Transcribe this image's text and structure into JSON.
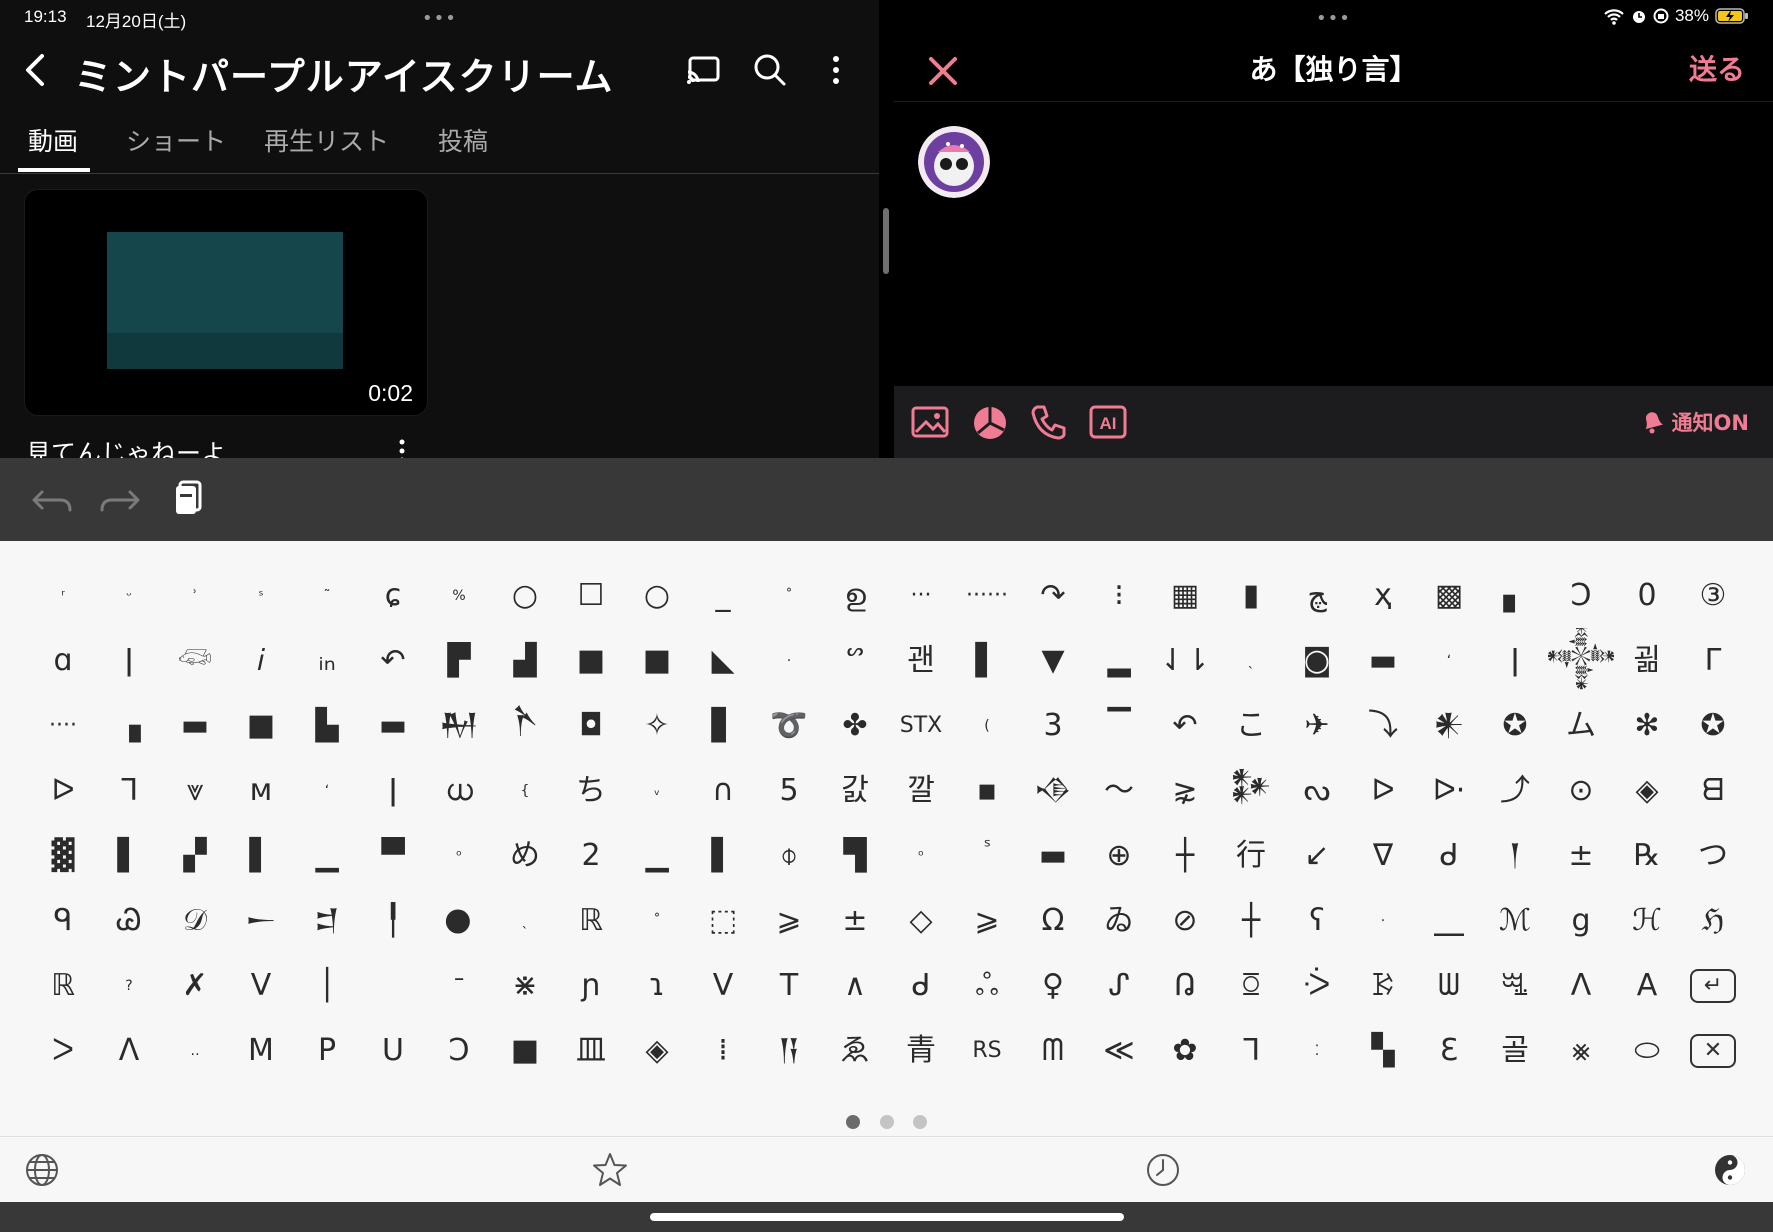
{
  "status_bar": {
    "time": "19:13",
    "date": "12月20日(土)",
    "battery": "38%",
    "dots_left": "•••",
    "dots_right": "•••"
  },
  "youtube": {
    "channel_title": "ミントパープルアイスクリーム",
    "tabs": [
      {
        "label": "動画",
        "active": true
      },
      {
        "label": "ショート",
        "active": false
      },
      {
        "label": "再生リスト",
        "active": false
      },
      {
        "label": "投稿",
        "active": false
      }
    ],
    "video": {
      "duration": "0:02",
      "title": "見てんじゃねーよ"
    }
  },
  "post": {
    "title": "あ【独り言】",
    "send_label": "送る",
    "notify_label": "通知ON",
    "accent_color": "#f07c93",
    "tool_icons": [
      "image-icon",
      "pie-icon",
      "phone-icon",
      "ai-icon"
    ],
    "ai_label": "AI"
  },
  "keyboard": {
    "toolbar_icons": [
      "undo-icon",
      "redo-icon",
      "clipboard-icon"
    ],
    "rows": [
      [
        "ʳ",
        "ᵕ",
        "ʾ",
        "ˢ",
        "˜",
        "ɕ",
        "%",
        "○",
        "☐",
        "○",
        "_",
        "˚",
        "ഉ",
        "···",
        "······",
        "↷",
        "⁝",
        "▦",
        "▮",
        "ﭻ",
        "ҳ",
        "▩",
        "▖",
        "Ɔ",
        "0",
        "③"
      ],
      [
        "ɑ",
        "ǀ",
        "𓆛",
        "𝑖",
        "ᵢₙ",
        "↶",
        "▛",
        "▟",
        "■",
        "■",
        "◣",
        "·",
        "ᔥ",
        "괜",
        "▌",
        "▼",
        "▂",
        "⇃⇂",
        "ˎ",
        "◙",
        "▬",
        "ʻ",
        "ǀ",
        "𒀱",
        "괾",
        "ᒥ"
      ],
      [
        "····",
        "▗",
        "▬",
        "■",
        "▙",
        "▬",
        "𒈹",
        "𒋻",
        "◘",
        "✧",
        "▋",
        "➰",
        "✤",
        "STX",
        "(",
        "3",
        "▔",
        "↶",
        "こ",
        "✈",
        "⤵",
        "𒀭",
        "✪",
        "ム",
        "✻",
        "✪"
      ],
      [
        "ᐅ",
        "ᒣ",
        "⩔",
        "ᴍ",
        "ʻ",
        "ǀ",
        "ധ",
        "{",
        "ち",
        "ᵥ",
        "∩",
        "5",
        "갌",
        "깔",
        "▪",
        "𒈾",
        "～",
        "⋧",
        "𒀯",
        "ᔓ",
        "ᐅ",
        "ᐅ·",
        "⤴",
        "⊙",
        "◈",
        "ᗺ"
      ],
      [
        "▓",
        "▌",
        "▞",
        "▌",
        "▁",
        "▀",
        "ᵒ",
        "め",
        "2",
        "▁",
        "▌",
        "⌽",
        "▜",
        "ᵒ",
        "ᷤ",
        "▬",
        "⊕",
        "┼",
        "行",
        "↙",
        "∇",
        "ᑯ",
        "𒁹",
        "±",
        "℞",
        "つ"
      ],
      [
        "ᑫ",
        "Ꮚ",
        "𝒟",
        "𒀸",
        "𒄑",
        "╿",
        "𒊹",
        "ˎ",
        "ℝ",
        "˚",
        "⬚",
        "⩾",
        "±",
        "◇",
        "⩾",
        "Ω",
        "ゐ",
        "⊘",
        "┼",
        "ʕ",
        "·",
        "⎽",
        "ℳ",
        "g",
        "ℋ",
        "ℌ"
      ],
      [
        "ℝ",
        "?",
        "✗",
        "ᐯ",
        "│",
        "",
        "ᐨ",
        "⋇",
        "ɲ",
        "ɿ",
        "ᐯ",
        "Т",
        "∧",
        "ᑯ",
        "ஃ",
        "♀",
        "ᔑ",
        "ᕡ",
        "ꗞ",
        "ᑂ",
        "ꗣ",
        "ᗯ",
        "ꗆ",
        "ᐱ",
        "A",
        "RET"
      ],
      [
        "ᐳ",
        "Λ",
        "‥",
        "M",
        "P",
        "U",
        "Ↄ",
        "■",
        "皿",
        "◈",
        "⁞",
        "𒀀",
        "ゑ",
        "青",
        "RS",
        "ᗰ",
        "≪",
        "✿",
        "ᒣ",
        "⁚",
        "▚",
        "Ɛ",
        "골",
        "⨳",
        "⬭",
        "DEL"
      ]
    ],
    "page_dots": 3,
    "active_page": 1,
    "bottom_icons": [
      "globe-icon",
      "star-icon",
      "clock-icon",
      "yin-yang-icon"
    ]
  }
}
